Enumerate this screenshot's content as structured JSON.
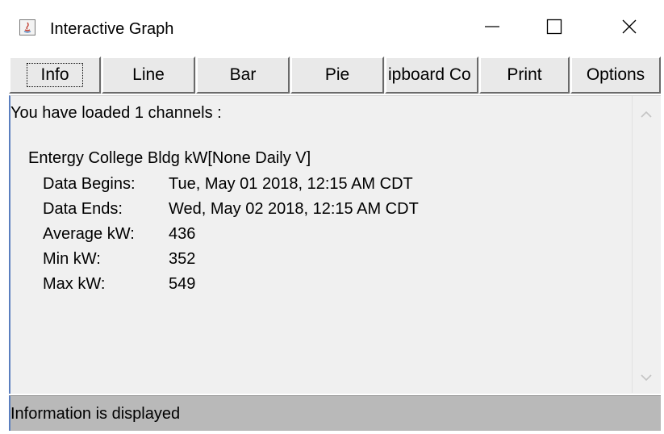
{
  "window": {
    "title": "Interactive Graph",
    "controls": {
      "minimize": "minimize-icon",
      "maximize": "maximize-icon",
      "close": "close-icon"
    }
  },
  "toolbar": {
    "buttons": [
      {
        "label": "Info",
        "focused": true
      },
      {
        "label": "Line"
      },
      {
        "label": "Bar"
      },
      {
        "label": "Pie"
      },
      {
        "label": "Clipboard Copy",
        "visible_label": "ipboard Co"
      },
      {
        "label": "Print"
      },
      {
        "label": "Options"
      }
    ]
  },
  "info": {
    "header": "You have loaded 1 channels :",
    "channel_name": "Entergy College Bldg kW[None Daily  V]",
    "rows": [
      {
        "label": "Data Begins:",
        "value": "Tue, May 01 2018, 12:15 AM CDT"
      },
      {
        "label": "Data Ends:",
        "value": "Wed, May 02 2018, 12:15 AM CDT"
      },
      {
        "label": "Average kW:",
        "value": "436"
      },
      {
        "label": "Min kW:",
        "value": "352"
      },
      {
        "label": "Max kW:",
        "value": "549"
      }
    ]
  },
  "status": {
    "text": "Information is displayed"
  },
  "colors": {
    "status_bg": "#b9b9b9",
    "panel_bg": "#f0f0f0",
    "accent_border": "#5b7fbf"
  }
}
